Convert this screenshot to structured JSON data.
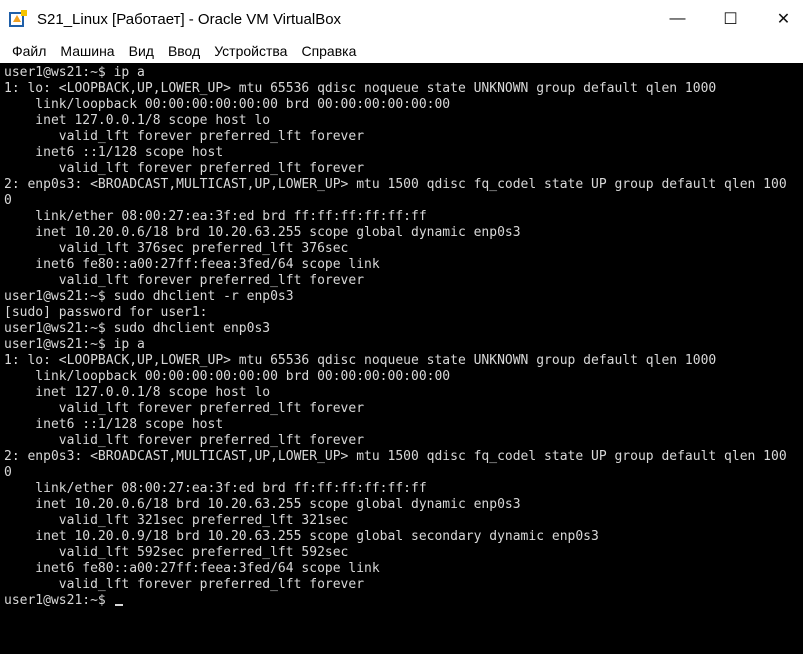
{
  "window": {
    "title": "S21_Linux [Работает] - Oracle VM VirtualBox",
    "icon": "virtualbox-icon",
    "controls": {
      "minimize": "—",
      "maximize": "☐",
      "close": "✕"
    }
  },
  "menu": {
    "items": [
      "Файл",
      "Машина",
      "Вид",
      "Ввод",
      "Устройства",
      "Справка"
    ]
  },
  "terminal": {
    "lines": [
      "user1@ws21:~$ ip a",
      "1: lo: <LOOPBACK,UP,LOWER_UP> mtu 65536 qdisc noqueue state UNKNOWN group default qlen 1000",
      "    link/loopback 00:00:00:00:00:00 brd 00:00:00:00:00:00",
      "    inet 127.0.0.1/8 scope host lo",
      "       valid_lft forever preferred_lft forever",
      "    inet6 ::1/128 scope host",
      "       valid_lft forever preferred_lft forever",
      "2: enp0s3: <BROADCAST,MULTICAST,UP,LOWER_UP> mtu 1500 qdisc fq_codel state UP group default qlen 100",
      "0",
      "    link/ether 08:00:27:ea:3f:ed brd ff:ff:ff:ff:ff:ff",
      "    inet 10.20.0.6/18 brd 10.20.63.255 scope global dynamic enp0s3",
      "       valid_lft 376sec preferred_lft 376sec",
      "    inet6 fe80::a00:27ff:feea:3fed/64 scope link",
      "       valid_lft forever preferred_lft forever",
      "user1@ws21:~$ sudo dhclient -r enp0s3",
      "[sudo] password for user1:",
      "user1@ws21:~$ sudo dhclient enp0s3",
      "user1@ws21:~$ ip a",
      "1: lo: <LOOPBACK,UP,LOWER_UP> mtu 65536 qdisc noqueue state UNKNOWN group default qlen 1000",
      "    link/loopback 00:00:00:00:00:00 brd 00:00:00:00:00:00",
      "    inet 127.0.0.1/8 scope host lo",
      "       valid_lft forever preferred_lft forever",
      "    inet6 ::1/128 scope host",
      "       valid_lft forever preferred_lft forever",
      "2: enp0s3: <BROADCAST,MULTICAST,UP,LOWER_UP> mtu 1500 qdisc fq_codel state UP group default qlen 100",
      "0",
      "    link/ether 08:00:27:ea:3f:ed brd ff:ff:ff:ff:ff:ff",
      "    inet 10.20.0.6/18 brd 10.20.63.255 scope global dynamic enp0s3",
      "       valid_lft 321sec preferred_lft 321sec",
      "    inet 10.20.0.9/18 brd 10.20.63.255 scope global secondary dynamic enp0s3",
      "       valid_lft 592sec preferred_lft 592sec",
      "    inet6 fe80::a00:27ff:feea:3fed/64 scope link",
      "       valid_lft forever preferred_lft forever"
    ],
    "prompt": "user1@ws21:~$ "
  },
  "colors": {
    "terminal_bg": "#000000",
    "terminal_fg": "#d8d8d8",
    "chrome_bg": "#ffffff"
  }
}
